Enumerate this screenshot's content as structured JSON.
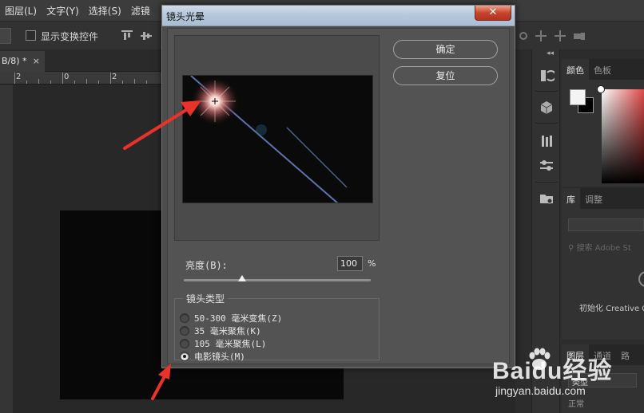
{
  "menubar": {
    "items": [
      "图层(L)",
      "文字(Y)",
      "选择(S)",
      "滤镜"
    ]
  },
  "optionsbar": {
    "show_transform_label": "显示变换控件"
  },
  "document": {
    "tab_label": "B/8) *",
    "tab_close": "×",
    "ruler_numbers": [
      "2",
      "0",
      "2"
    ]
  },
  "dialog": {
    "title": "镜头光晕",
    "close_glyph": "✕",
    "ok_label": "确定",
    "reset_label": "复位",
    "brightness_label": "亮度(B):",
    "brightness_value": "100",
    "brightness_unit": "%",
    "brightness_fraction": 0.31,
    "lens_group_title": "镜头类型",
    "lens_options": [
      {
        "label": "50-300 毫米变焦(Z)",
        "selected": false
      },
      {
        "label": "35 毫米聚焦(K)",
        "selected": false
      },
      {
        "label": "105 毫米聚焦(L)",
        "selected": false
      },
      {
        "label": "电影镜头(M)",
        "selected": true
      }
    ]
  },
  "panels": {
    "color_tabs": [
      "颜色",
      "色板"
    ],
    "library_tabs": [
      "库",
      "调整"
    ],
    "library_search_placeholder": "搜索 Adobe St",
    "library_init_text": "初始化 Creative C",
    "layers_tabs": [
      "图层",
      "通道",
      "路"
    ],
    "layers_kind": "类型",
    "layers_blend": "正常"
  },
  "colors": {
    "accent_arrow": "#e8322a",
    "dialog_title_bar": "#b7c8dc",
    "close_button": "#c8462d"
  },
  "watermark": {
    "brand": "Baidu经验",
    "url": "jingyan.baidu.com"
  }
}
